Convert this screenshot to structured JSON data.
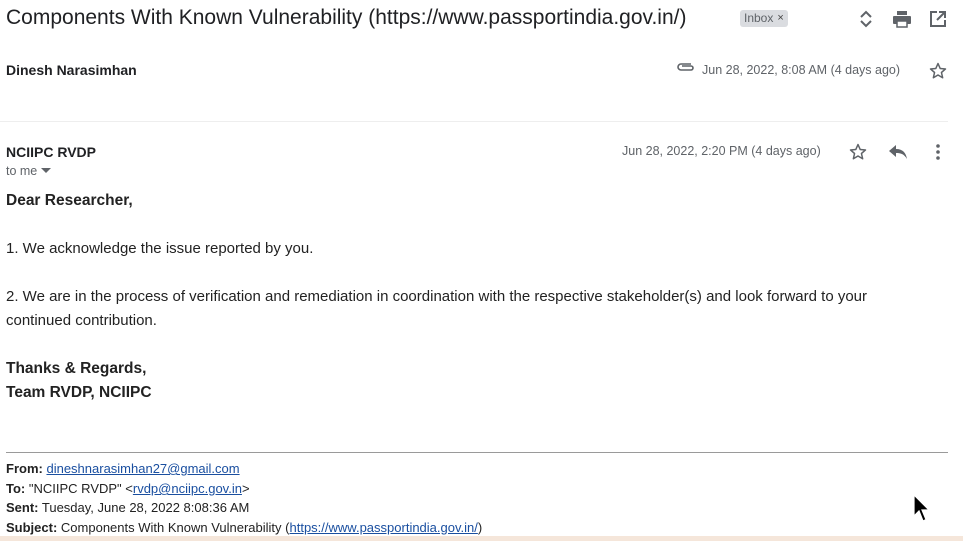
{
  "subject": "Components With Known Vulnerability (https://www.passportindia.gov.in/)",
  "label_chip": {
    "text": "Inbox",
    "remove_glyph": "×"
  },
  "header_icons": [
    "expand-collapse-icon",
    "print-icon",
    "open-in-new-window-icon"
  ],
  "message1": {
    "sender": "Dinesh Narasimhan",
    "date": "Jun 28, 2022, 8:08 AM (4 days ago)",
    "icons": [
      "attachment-icon",
      "star-icon"
    ]
  },
  "message2": {
    "sender": "NCIIPC RVDP",
    "recipient": "to me",
    "date": "Jun 28, 2022, 2:20 PM (4 days ago)",
    "icons": [
      "star-icon",
      "reply-icon",
      "more-options-icon"
    ],
    "body": {
      "greeting": "Dear Researcher,",
      "para1": "1. We acknowledge the issue reported by you.",
      "para2_line1": "2. We are in the process of verification and remediation in coordination with the respective stakeholder(s) and look forward to your",
      "para2_line2": "continued contribution.",
      "signoff1": "Thanks & Regards,",
      "signoff2": "Team RVDP, NCIIPC"
    },
    "quoted": {
      "from_label": "From:",
      "from_email": "dineshnarasimhan27@gmail.com",
      "to_label": "To:",
      "to_name": "\"NCIIPC RVDP\" <",
      "to_email": "rvdp@nciipc.gov.in",
      "to_close": ">",
      "sent_label": "Sent:",
      "sent_value": "Tuesday, June 28, 2022 8:08:36 AM",
      "subject_label": "Subject:",
      "subject_prefix": "Components With Known Vulnerability (",
      "subject_link": "https://www.passportindia.gov.in/",
      "subject_suffix": ")"
    }
  },
  "colors": {
    "icon": "#5f6368",
    "link": "#1a4fa0",
    "chip": "#dadce0"
  }
}
